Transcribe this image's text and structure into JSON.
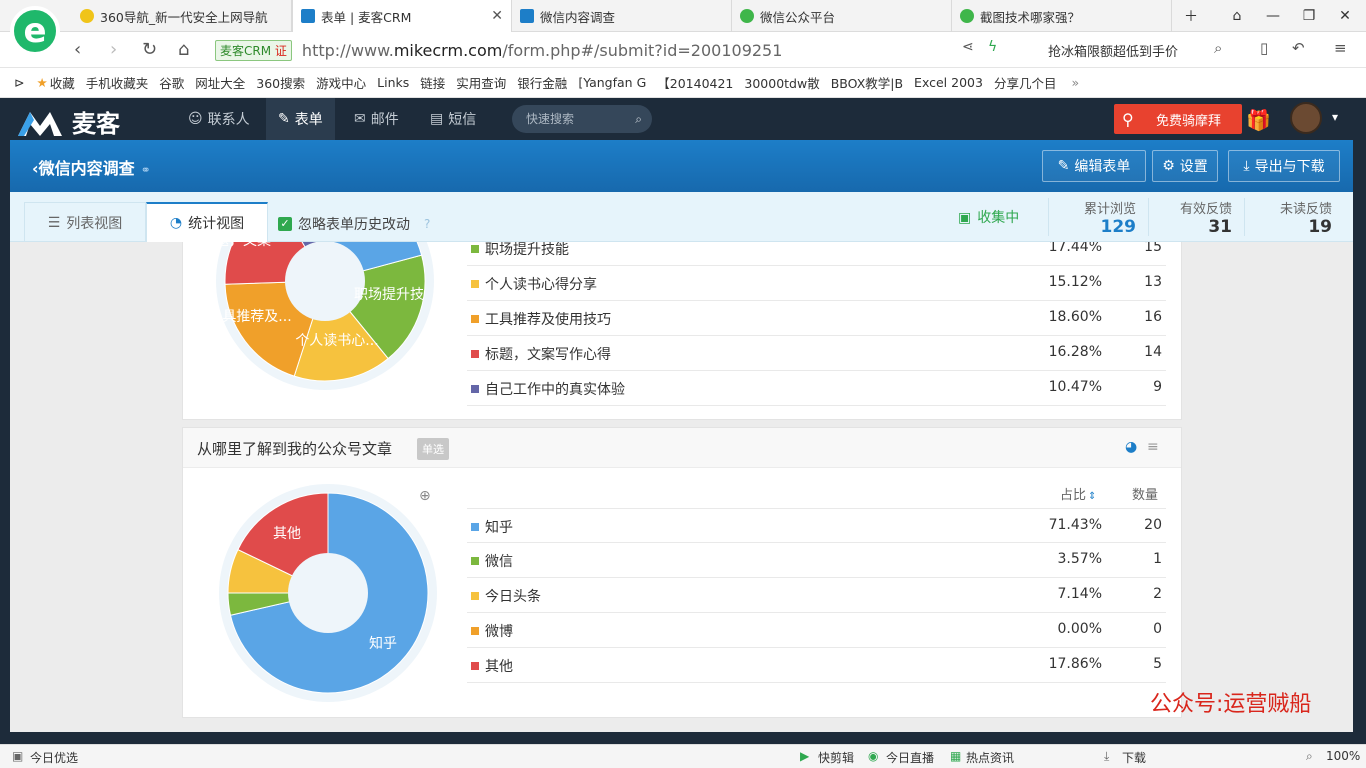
{
  "browser": {
    "tabs": [
      {
        "label": "360导航_新一代安全上网导航"
      },
      {
        "label": "表单 | 麦客CRM"
      },
      {
        "label": "微信内容调查"
      },
      {
        "label": "微信公众平台"
      },
      {
        "label": "截图技术哪家强？"
      }
    ],
    "cert_label": "麦客CRM",
    "cert_mark": "证",
    "url_prefix": "http://www.",
    "url_domain": "mikecrm.com",
    "url_suffix": "/form.php#/submit?id=200109251",
    "search_ad": "抢冰箱限额超低到手价",
    "bookmarks": [
      "收藏",
      "手机收藏夹",
      "谷歌",
      "网址大全",
      "360搜索",
      "游戏中心",
      "Links",
      "链接",
      "实用查询",
      "银行金融",
      "[Yangfan G",
      "【20140421",
      "30000tdw散",
      "BBOX教学|B",
      "Excel 2003",
      "分享几个目"
    ]
  },
  "app": {
    "brand": "麦客",
    "nav": [
      "联系人",
      "表单",
      "邮件",
      "短信"
    ],
    "quick_search_placeholder": "快速搜索",
    "ride_btn": "免费骑摩拜",
    "form_title": "微信内容调查",
    "actions": {
      "edit": "编辑表单",
      "settings": "设置",
      "export": "导出与下载"
    },
    "views": {
      "list": "列表视图",
      "stats": "统计视图"
    },
    "ignore_history": "忽略表单历史改动",
    "collect_status": "收集中",
    "stats": [
      {
        "label": "累计浏览",
        "value": "129"
      },
      {
        "label": "有效反馈",
        "value": "31"
      },
      {
        "label": "未读反馈",
        "value": "19"
      }
    ]
  },
  "q1": {
    "slice_labels": [
      "题，文案",
      "职场提升技",
      "具推荐及...",
      "个人读书心..."
    ],
    "rows": [
      {
        "label": "职场提升技能",
        "pct": "17.44%",
        "count": "15",
        "color": "#7cb83e"
      },
      {
        "label": "个人读书心得分享",
        "pct": "15.12%",
        "count": "13",
        "color": "#f6c23e"
      },
      {
        "label": "工具推荐及使用技巧",
        "pct": "18.60%",
        "count": "16",
        "color": "#f0a02a"
      },
      {
        "label": "标题，文案写作心得",
        "pct": "16.28%",
        "count": "14",
        "color": "#e04b4b"
      },
      {
        "label": "自己工作中的真实体验",
        "pct": "10.47%",
        "count": "9",
        "color": "#6466a8"
      }
    ]
  },
  "q2": {
    "title": "从哪里了解到我的公众号文章",
    "badge": "单选",
    "col_pct": "占比",
    "col_count": "数量",
    "slice_labels": [
      "其他",
      "知乎"
    ],
    "rows": [
      {
        "label": "知乎",
        "pct": "71.43%",
        "count": "20",
        "color": "#5aa5e6"
      },
      {
        "label": "微信",
        "pct": "3.57%",
        "count": "1",
        "color": "#7cb83e"
      },
      {
        "label": "今日头条",
        "pct": "7.14%",
        "count": "2",
        "color": "#f6c23e"
      },
      {
        "label": "微博",
        "pct": "0.00%",
        "count": "0",
        "color": "#f0a02a"
      },
      {
        "label": "其他",
        "pct": "17.86%",
        "count": "5",
        "color": "#e04b4b"
      }
    ]
  },
  "chart_data": [
    {
      "type": "pie",
      "categories": [
        "职场提升技能",
        "个人读书心得分享",
        "工具推荐及使用技巧",
        "标题，文案写作心得",
        "自己工作中的真实体验"
      ],
      "values": [
        15,
        13,
        16,
        14,
        9
      ]
    },
    {
      "type": "pie",
      "categories": [
        "知乎",
        "微信",
        "今日头条",
        "微博",
        "其他"
      ],
      "values": [
        20,
        1,
        2,
        0,
        5
      ]
    }
  ],
  "watermark": "公众号:运营贼船",
  "statusbar": {
    "left": "今日优选",
    "items": [
      "快剪辑",
      "今日直播",
      "热点资讯",
      "下载"
    ],
    "zoom": "100%"
  }
}
